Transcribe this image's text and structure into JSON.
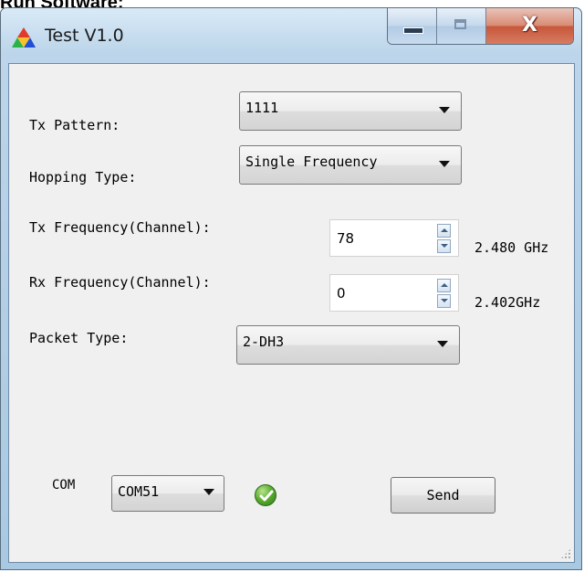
{
  "page": {
    "heading": "Run Software:"
  },
  "window": {
    "title": "Test V1.0",
    "app_icon": "colored-triangles-icon",
    "close_glyph": "X"
  },
  "form": {
    "tx_pattern": {
      "label": "Tx Pattern:",
      "value": "1111"
    },
    "hopping_type": {
      "label": "Hopping Type:",
      "value": "Single Frequency"
    },
    "tx_frequency": {
      "label": "Tx Frequency(Channel):",
      "value": "78",
      "freq": "2.480 GHz"
    },
    "rx_frequency": {
      "label": "Rx Frequency(Channel):",
      "value": "0",
      "freq": "2.402GHz"
    },
    "packet_type": {
      "label": "Packet Type:",
      "value": "2-DH3"
    },
    "com": {
      "label": "COM",
      "value": "COM51"
    },
    "status": {
      "icon": "checkmark-icon",
      "color": "#3c9a26"
    },
    "send_label": "Send"
  }
}
